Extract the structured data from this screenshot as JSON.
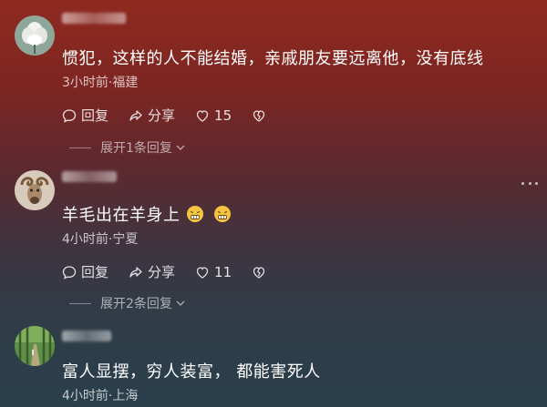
{
  "comments": [
    {
      "text": "惯犯，这样的人不能结婚，亲戚朋友要远离他，没有底线",
      "meta": "3小时前·福建",
      "reply_label": "回复",
      "share_label": "分享",
      "like_count": "15",
      "expand_label": "展开1条回复",
      "avatar": "white-flower-avatar"
    },
    {
      "text": "羊毛出在羊身上",
      "emojis": [
        "grimace-emoji",
        "grimace-emoji"
      ],
      "meta": "4小时前·宁夏",
      "reply_label": "回复",
      "share_label": "分享",
      "like_count": "11",
      "expand_label": "展开2条回复",
      "avatar": "ram-avatar"
    },
    {
      "text": "富人显摆，穷人装富， 都能害死人",
      "meta": "4小时前·上海",
      "avatar": "forest-path-avatar"
    }
  ],
  "colors": {
    "background_top": "#8e2a20",
    "background_bottom": "#2a3f4c",
    "text": "#ffffff"
  }
}
